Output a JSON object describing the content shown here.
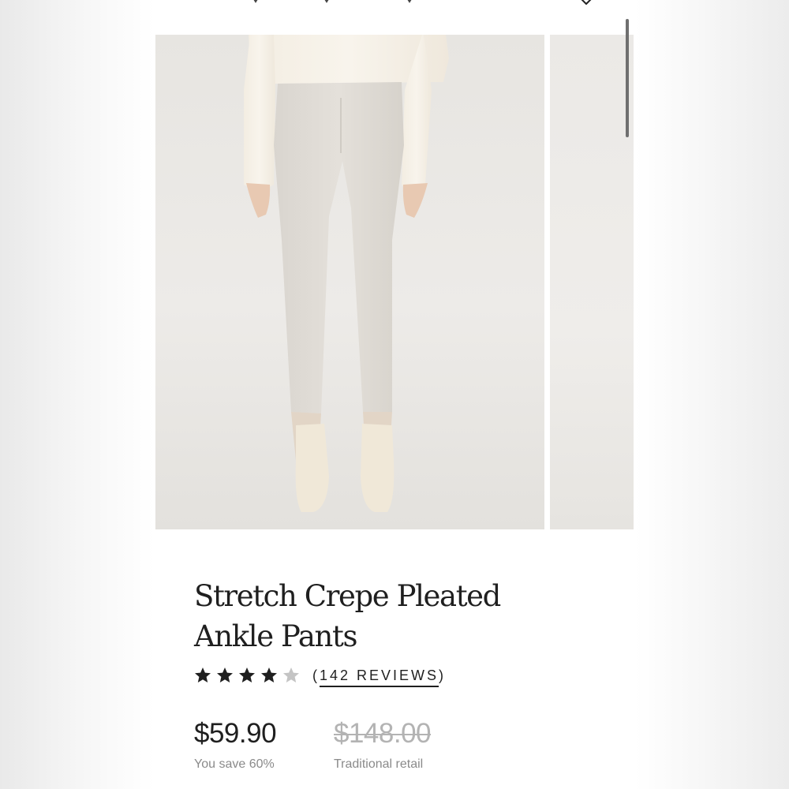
{
  "product": {
    "title": "Stretch Crepe Pleated Ankle Pants",
    "rating": 4,
    "rating_max": 5,
    "reviews_open": "(",
    "reviews_label": "142 REVIEWS",
    "reviews_close": ")",
    "price": "$59.90",
    "savings": "You save 60%",
    "original_price": "$148.00",
    "original_price_label": "Traditional retail"
  },
  "icons": {
    "favorite": "heart-icon",
    "star_filled": "star-icon",
    "star_empty": "star-outline-icon"
  },
  "gallery": {
    "images": [
      "model-wearing-pants-front",
      "next-image-preview"
    ]
  },
  "colors": {
    "text": "#1f1f1f",
    "muted": "#8a8a8a",
    "strike": "#b3b3b3",
    "star_on": "#1f1f1f",
    "star_off": "#c4c4c4"
  }
}
